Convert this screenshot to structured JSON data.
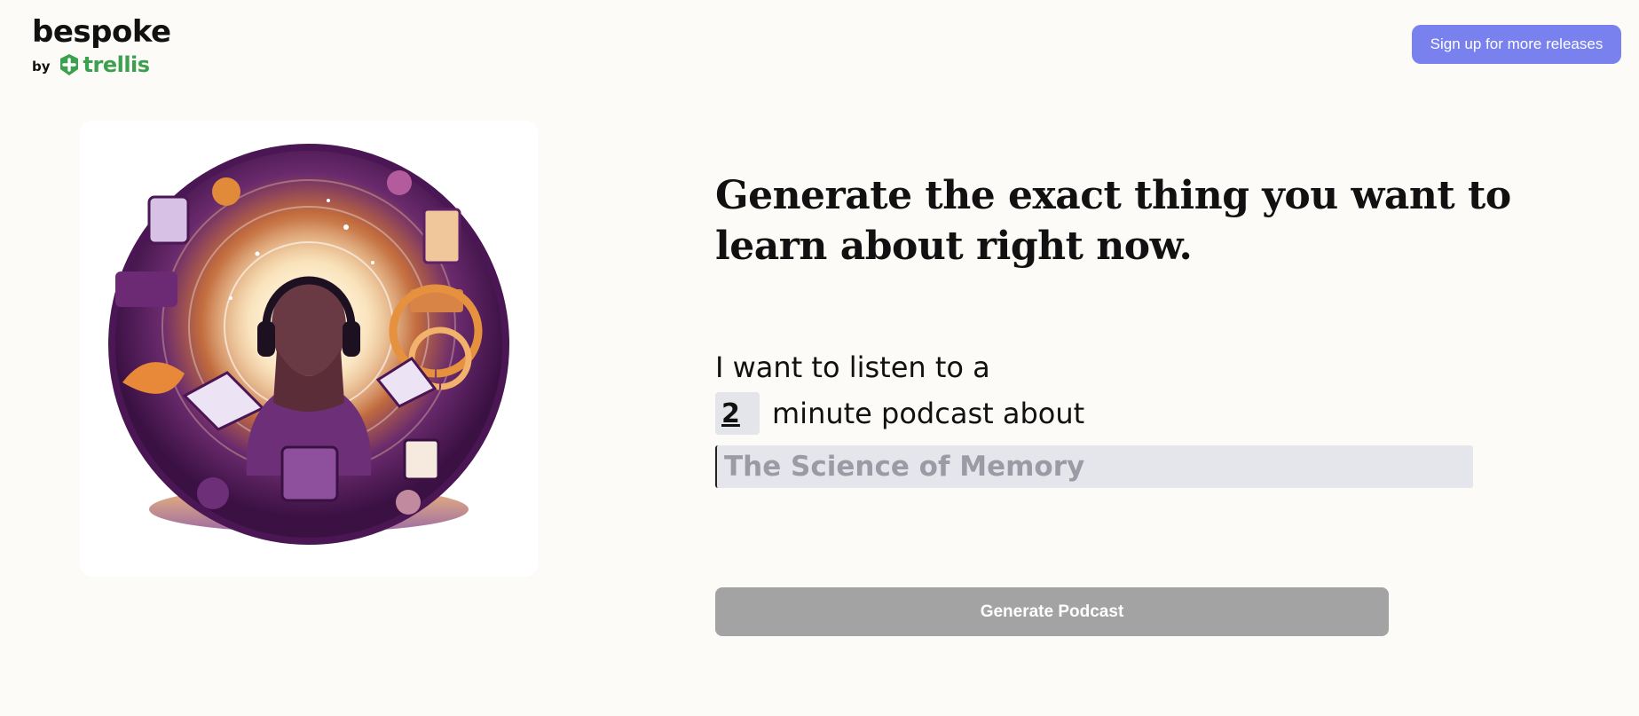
{
  "brand": {
    "name": "bespoke",
    "by": "by",
    "partner": "trellis",
    "partner_color": "#3da04e"
  },
  "header": {
    "signup_label": "Sign up for more releases",
    "signup_color": "#7881ed"
  },
  "hero": {
    "illustration_subject": "woman-with-headphones-podcast-illustration"
  },
  "main": {
    "headline": "Generate the exact thing you want to learn about right now.",
    "prompt_prefix": "I want to listen to a",
    "duration_value": "2",
    "duration_suffix": "minute podcast about",
    "topic_placeholder": "The Science of Memory",
    "topic_value": "",
    "generate_label": "Generate Podcast",
    "generate_color": "#a3a3a3"
  }
}
